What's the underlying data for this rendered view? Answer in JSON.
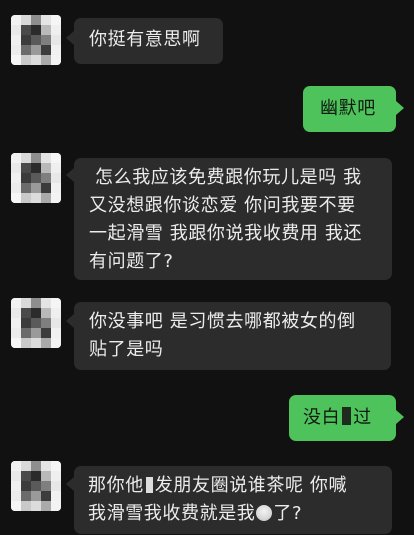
{
  "messages": [
    {
      "id": "m1",
      "sender": "other",
      "text": "你挺有意思啊"
    },
    {
      "id": "m2",
      "sender": "me",
      "text": "幽默吧"
    },
    {
      "id": "m3",
      "sender": "other",
      "lines": [
        "怎么我应该免费跟你玩儿是吗 我",
        "又没想跟你谈恋爱 你问我要不要",
        "一起滑雪 我跟你说我收费用 我还",
        "有问题了?"
      ]
    },
    {
      "id": "m4",
      "sender": "other",
      "lines": [
        "你没事吧 是习惯去哪都被女的倒",
        "贴了是吗"
      ]
    },
    {
      "id": "m5",
      "sender": "me",
      "text_before": "没白",
      "text_after": "过"
    },
    {
      "id": "m6",
      "sender": "other",
      "line1_before": "那你他",
      "line1_after": "发朋友圈说谁茶呢 你喊",
      "line2_before": "我滑雪我收费就是我",
      "line2_after": "了?"
    }
  ],
  "colors": {
    "background": "#111111",
    "incoming_bubble": "#2c2c2c",
    "outgoing_bubble": "#4fc35b",
    "text_light": "#ececec"
  },
  "avatar_icon": "pixelated-avatar-icon",
  "emoji_icon": "tea-cup-icon"
}
